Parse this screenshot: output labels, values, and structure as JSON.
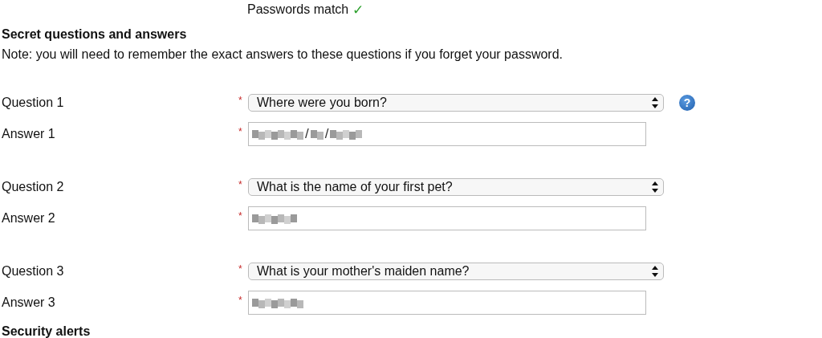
{
  "password_status": {
    "text": "Passwords match",
    "mark": "✓"
  },
  "section": {
    "title": "Secret questions and answers",
    "note": "Note: you will need to remember the exact answers to these questions if you forget your password."
  },
  "questions": [
    {
      "label": "Question 1",
      "required_mark": "*",
      "value": "Where were you born?",
      "help": "?",
      "answer_label": "Answer 1",
      "answer_required_mark": "*",
      "answer_segments": [
        {
          "kind": "blur"
        },
        {
          "kind": "text",
          "text": "/"
        },
        {
          "kind": "blur"
        },
        {
          "kind": "text",
          "text": "/"
        },
        {
          "kind": "blur"
        }
      ]
    },
    {
      "label": "Question 2",
      "required_mark": "*",
      "value": "What is the name of your first pet?",
      "answer_label": "Answer 2",
      "answer_required_mark": "*",
      "answer_segments": [
        {
          "kind": "blur"
        }
      ]
    },
    {
      "label": "Question 3",
      "required_mark": "*",
      "value": "What is your mother's maiden name?",
      "answer_label": "Answer 3",
      "answer_required_mark": "*",
      "answer_segments": [
        {
          "kind": "blur"
        }
      ]
    }
  ],
  "next_section": {
    "title": "Security alerts"
  }
}
